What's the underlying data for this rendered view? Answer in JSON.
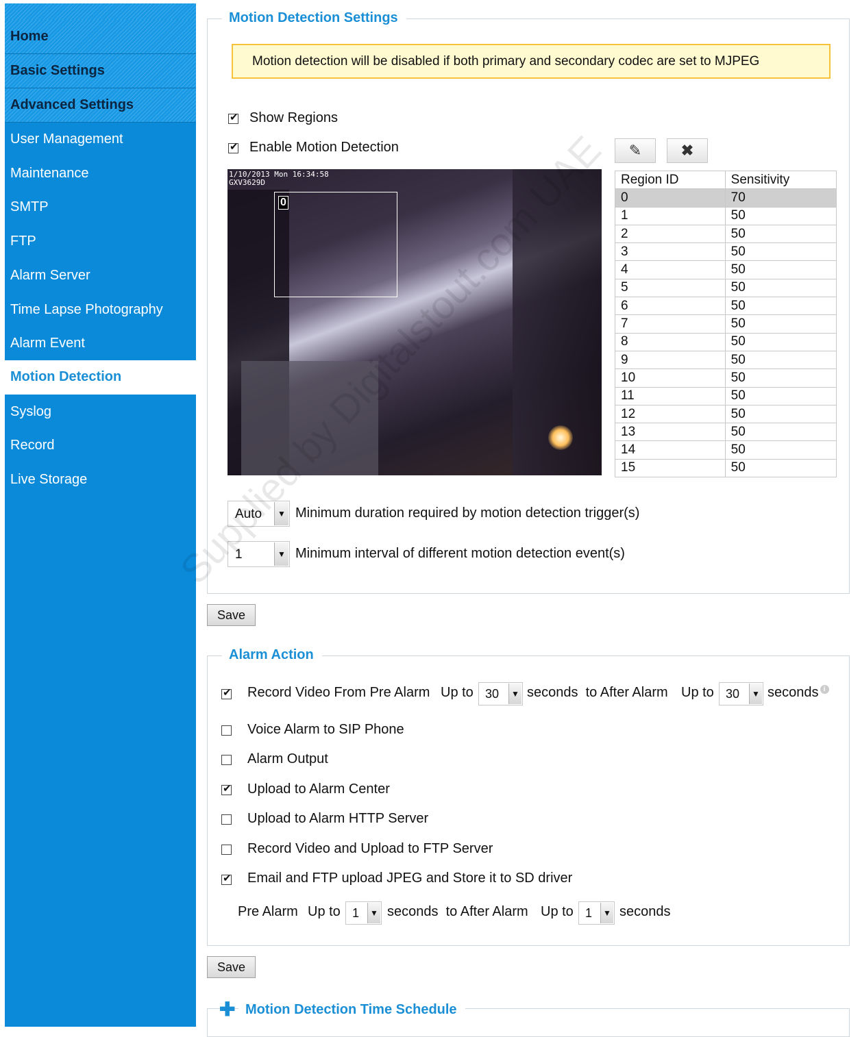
{
  "sidebar": {
    "home": "Home",
    "basic_settings": "Basic Settings",
    "advanced_settings": "Advanced Settings",
    "items": [
      "User Management",
      "Maintenance",
      "SMTP",
      "FTP",
      "Alarm Server",
      "Time Lapse Photography",
      "Alarm Event",
      "Motion Detection",
      "Syslog",
      "Record",
      "Live Storage"
    ],
    "active": "Motion Detection"
  },
  "motion": {
    "title": "Motion Detection Settings",
    "warning": "Motion detection will be disabled if both primary and secondary codec are set to MJPEG",
    "show_regions": {
      "label": "Show Regions",
      "checked": true
    },
    "enable_motion": {
      "label": "Enable Motion Detection",
      "checked": true
    },
    "edit_icon": "pencil-icon",
    "delete_icon": "x-icon",
    "preview": {
      "timestamp": "1/10/2013 Mon 16:34:58",
      "camera_label": "GXV3629D",
      "region_label": "0"
    },
    "table": {
      "headers": [
        "Region ID",
        "Sensitivity"
      ],
      "rows": [
        [
          "0",
          "70"
        ],
        [
          "1",
          "50"
        ],
        [
          "2",
          "50"
        ],
        [
          "3",
          "50"
        ],
        [
          "4",
          "50"
        ],
        [
          "5",
          "50"
        ],
        [
          "6",
          "50"
        ],
        [
          "7",
          "50"
        ],
        [
          "8",
          "50"
        ],
        [
          "9",
          "50"
        ],
        [
          "10",
          "50"
        ],
        [
          "11",
          "50"
        ],
        [
          "12",
          "50"
        ],
        [
          "13",
          "50"
        ],
        [
          "14",
          "50"
        ],
        [
          "15",
          "50"
        ]
      ],
      "selected_row": 0
    },
    "min_duration": {
      "value": "Auto",
      "label": "Minimum duration required by motion detection trigger(s)"
    },
    "min_interval": {
      "value": "1",
      "label": "Minimum interval of different motion detection event(s)"
    },
    "save": "Save"
  },
  "alarm": {
    "title": "Alarm Action",
    "record_pre": {
      "label": "Record Video From Pre Alarm",
      "checked": true
    },
    "up_to": "Up to",
    "pre_value": "30",
    "seconds_to_after": "seconds  to After Alarm",
    "post_value": "30",
    "seconds": "seconds",
    "info_icon": "info-icon",
    "options": [
      {
        "label": "Voice Alarm to SIP Phone",
        "checked": false
      },
      {
        "label": "Alarm Output",
        "checked": false
      },
      {
        "label": "Upload to Alarm Center",
        "checked": true
      },
      {
        "label": "Upload to Alarm HTTP Server",
        "checked": false
      },
      {
        "label": "Record Video and Upload to FTP Server",
        "checked": false
      },
      {
        "label": "Email and FTP upload JPEG and Store it to SD driver",
        "checked": true
      }
    ],
    "pre_alarm_label": "Pre Alarm",
    "email_pre_value": "1",
    "email_post_value": "1",
    "save": "Save"
  },
  "schedule": {
    "title": "Motion Detection Time Schedule",
    "expand_icon": "plus-icon"
  },
  "watermark": "Supplied by Digitalstout.com UAE"
}
